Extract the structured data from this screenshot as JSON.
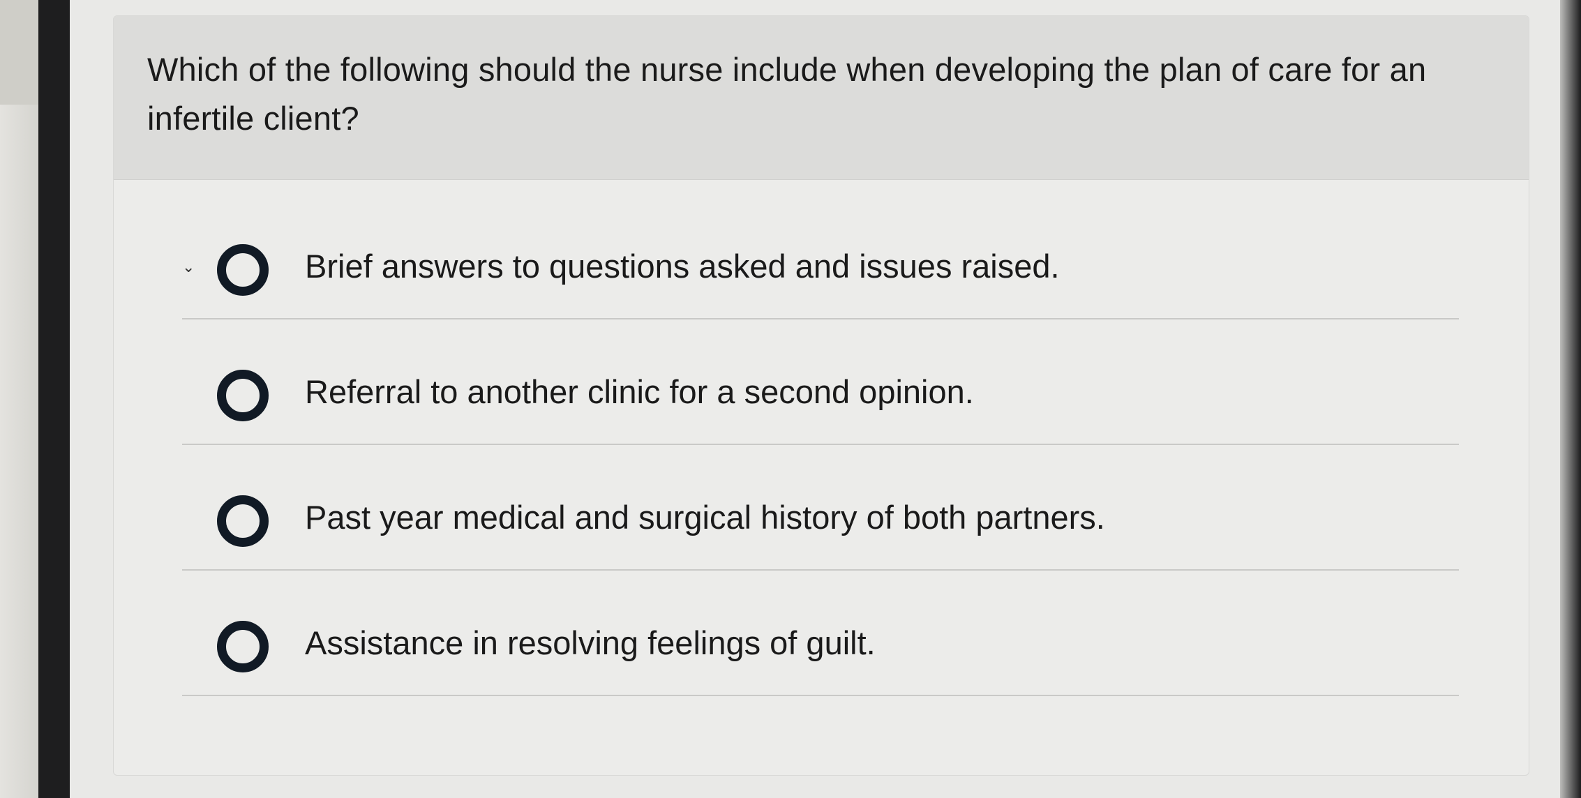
{
  "question": {
    "text": "Which of the following should the nurse include when developing the plan of care for an infertile client?"
  },
  "options": [
    {
      "label": "Brief answers to questions asked and issues raised.",
      "selected": false
    },
    {
      "label": "Referral to another clinic for a second opinion.",
      "selected": false
    },
    {
      "label": "Past year medical and surgical history of both partners.",
      "selected": false
    },
    {
      "label": "Assistance in resolving feelings of guilt.",
      "selected": false
    }
  ],
  "icons": {
    "radio": "radio-button-icon",
    "marker": "check-mark-icon"
  },
  "colors": {
    "radio_ring": "#111a25",
    "header_bg": "#dcdcda",
    "card_bg": "#ececea"
  }
}
